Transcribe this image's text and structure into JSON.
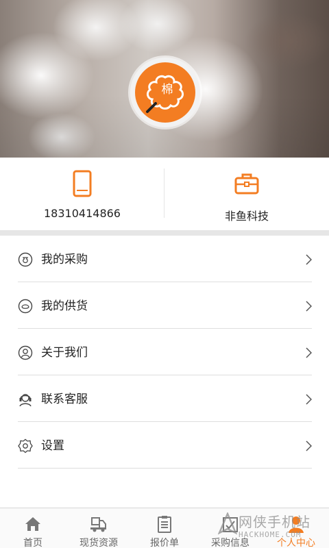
{
  "header": {
    "logo_text": "棉"
  },
  "profile": {
    "phone": "18310414866",
    "company": "非鱼科技"
  },
  "menu": {
    "items": [
      {
        "label": "我的采购",
        "icon": "money-bag-icon"
      },
      {
        "label": "我的供货",
        "icon": "supply-icon"
      },
      {
        "label": "关于我们",
        "icon": "user-icon"
      },
      {
        "label": "联系客服",
        "icon": "headset-icon"
      },
      {
        "label": "设置",
        "icon": "gear-icon"
      }
    ]
  },
  "tabbar": {
    "tabs": [
      {
        "label": "首页",
        "icon": "home-icon"
      },
      {
        "label": "现货资源",
        "icon": "truck-icon"
      },
      {
        "label": "报价单",
        "icon": "clipboard-icon"
      },
      {
        "label": "采购信息",
        "icon": "purchase-info-icon"
      },
      {
        "label": "个人中心",
        "icon": "person-icon"
      }
    ],
    "active_index": 4
  },
  "watermark": {
    "text": "网侠手机站",
    "sub": "HACKHOME.COM"
  },
  "colors": {
    "accent": "#f37d22",
    "divider": "#dedede",
    "text": "#222222"
  }
}
